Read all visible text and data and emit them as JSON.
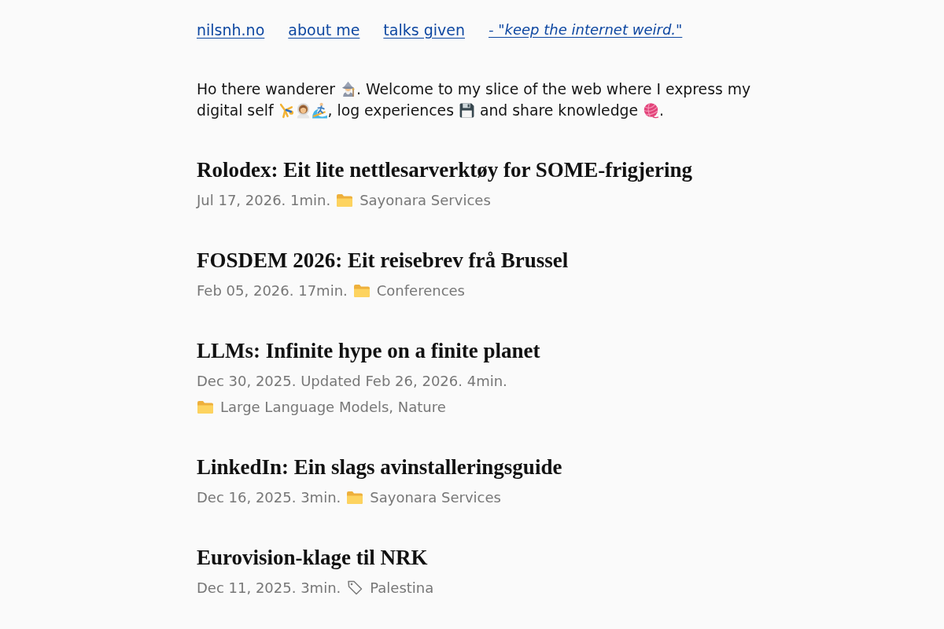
{
  "nav": [
    {
      "kind": "link",
      "label": "nilsnh.no"
    },
    {
      "kind": "link",
      "label": "about me"
    },
    {
      "kind": "link",
      "label": "talks given"
    },
    {
      "kind": "quote",
      "label": "- \"keep the internet weird.\""
    }
  ],
  "intro": {
    "lines": [
      [
        "Ho there wanderer",
        ". Welcome to my slice of the web where I express my"
      ],
      [
        "digital self",
        ", log experiences",
        "and share knowledge",
        "."
      ]
    ]
  },
  "posts": [
    {
      "title": "Rolodex: Eit lite nettlesarverktøy for SOME-frigjering",
      "meta": "Jul 17, 2026. 1min.",
      "taxonomy": {
        "kind": "category",
        "label": "Sayonara Services"
      }
    },
    {
      "title": "FOSDEM 2026: Eit reisebrev frå Brussel",
      "meta": "Feb 05, 2026. 17min.",
      "taxonomy": {
        "kind": "category",
        "label": "Conferences"
      }
    },
    {
      "title": "LLMs: Infinite hype on a finite planet",
      "meta": "Dec 30, 2025. Updated Feb 26, 2026. 4min.",
      "taxonomy": {
        "kind": "category",
        "label": "Large Language Models, Nature"
      }
    },
    {
      "title": "LinkedIn: Ein slags avinstalleringsguide",
      "meta": "Dec 16, 2025. 3min.",
      "taxonomy": {
        "kind": "category",
        "label": "Sayonara Services"
      }
    },
    {
      "title": "Eurovision-klage til NRK",
      "meta": "Dec 11, 2025. 3min.",
      "taxonomy": {
        "kind": "tag",
        "label": "Palestina"
      }
    }
  ]
}
